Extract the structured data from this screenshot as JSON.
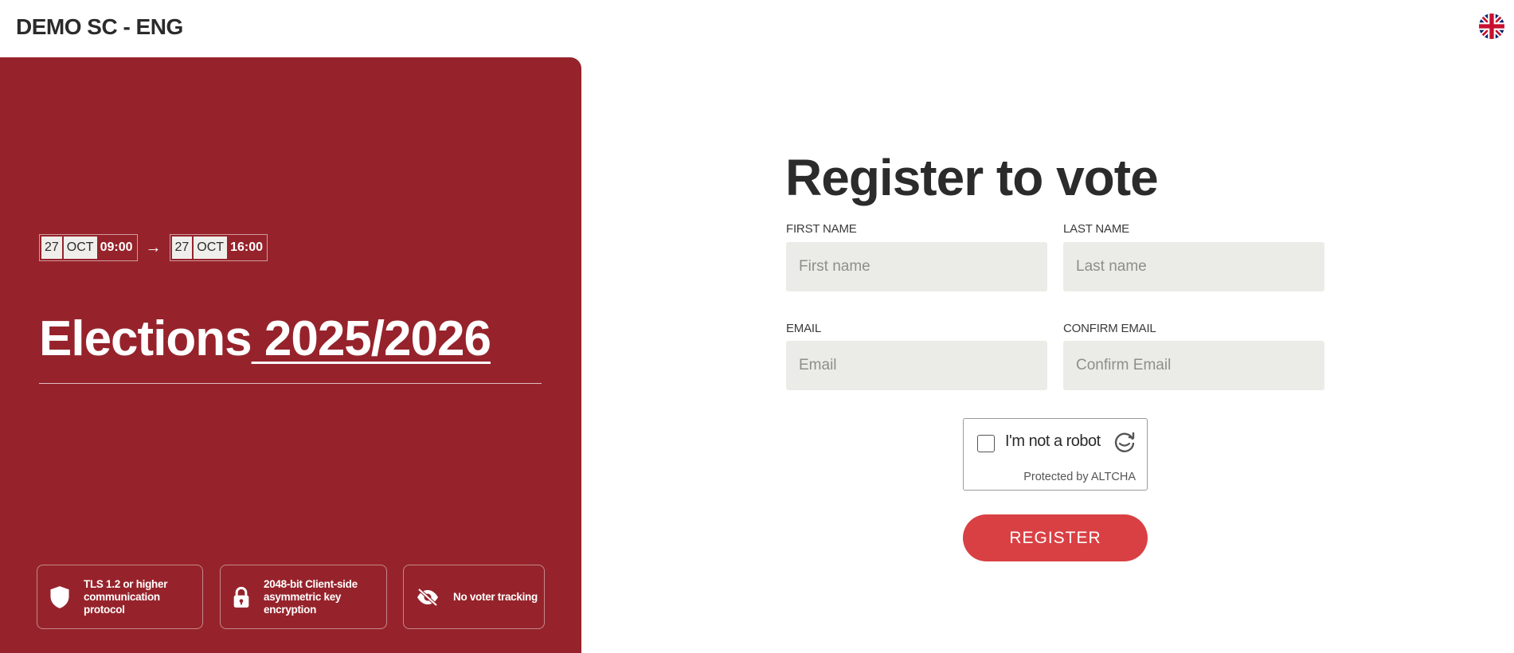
{
  "header": {
    "site_title": "DEMO SC - ENG",
    "language_flag": "uk-flag-icon"
  },
  "election": {
    "start": {
      "day": "27",
      "month": "OCT",
      "time": "09:00"
    },
    "end": {
      "day": "27",
      "month": "OCT",
      "time": "16:00"
    },
    "title_prefix": "Elections",
    "title_year": " 2025/2026"
  },
  "features": [
    {
      "icon": "shield-icon",
      "text": "TLS 1.2 or higher communication protocol"
    },
    {
      "icon": "lock-icon",
      "text": "2048-bit Client-side asymmetric key encryption"
    },
    {
      "icon": "eye-off-icon",
      "text": "No voter tracking"
    }
  ],
  "form": {
    "title": "Register to vote",
    "first_name": {
      "label": "FIRST NAME",
      "placeholder": "First name",
      "value": ""
    },
    "last_name": {
      "label": "LAST NAME",
      "placeholder": "Last name",
      "value": ""
    },
    "email": {
      "label": "EMAIL",
      "placeholder": "Email",
      "value": ""
    },
    "confirm_email": {
      "label": "CONFIRM EMAIL",
      "placeholder": "Confirm Email",
      "value": ""
    },
    "captcha": {
      "label": "I'm not a robot",
      "protected_by": "Protected by ALTCHA",
      "checked": false
    },
    "submit_label": "REGISTER"
  },
  "colors": {
    "panel": "#96232b",
    "button": "#d94044",
    "input_bg": "#ebebe7",
    "text": "#2b2b2b"
  }
}
